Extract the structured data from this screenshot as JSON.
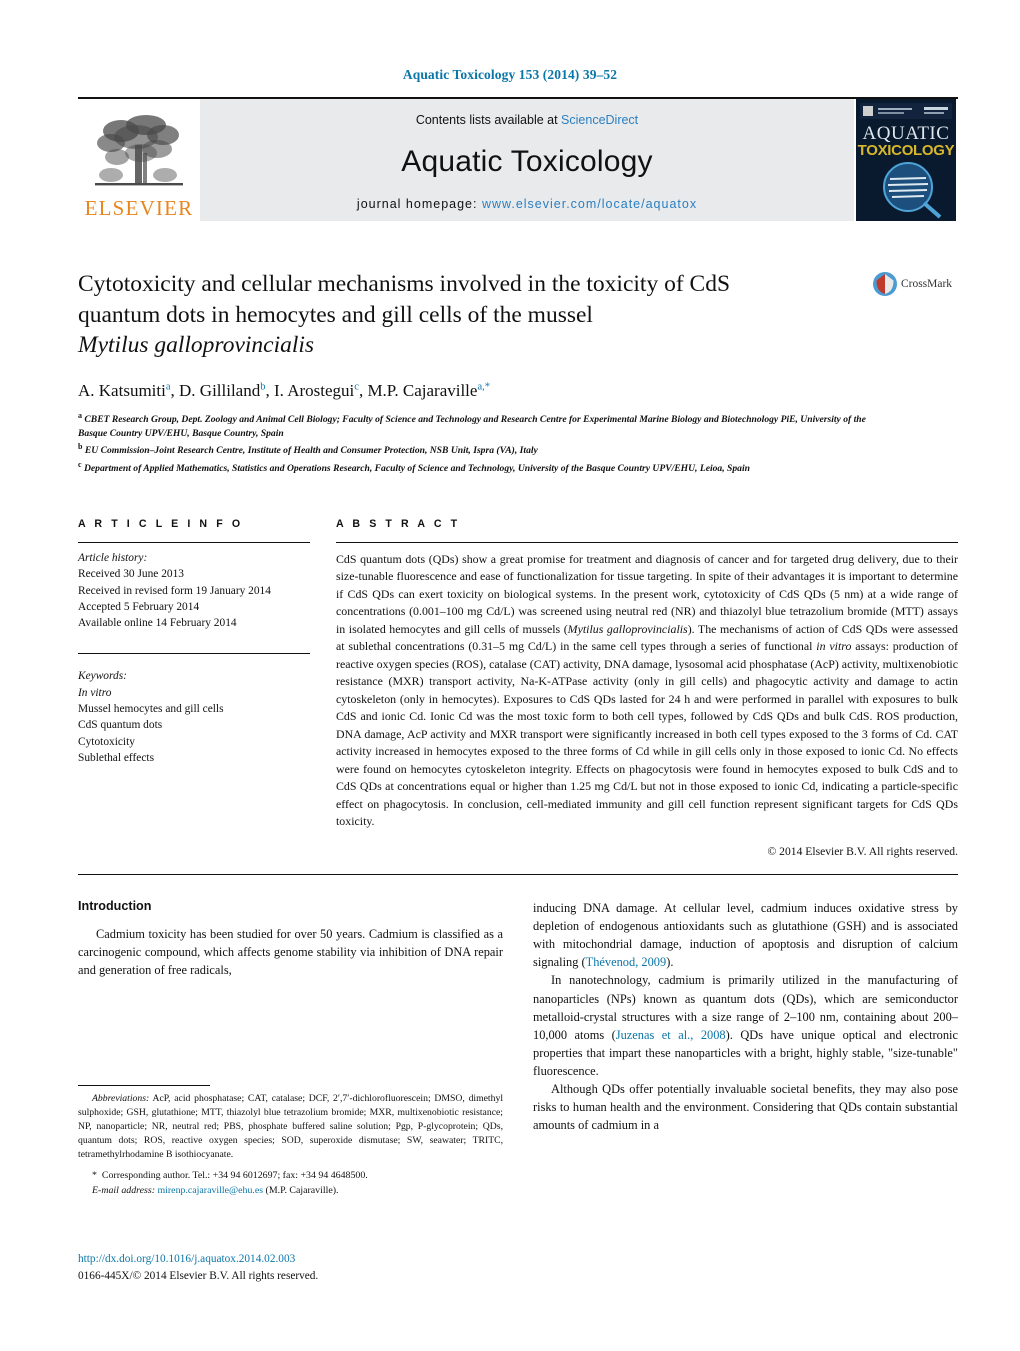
{
  "journal_ref": "Aquatic Toxicology 153 (2014) 39–52",
  "masthead": {
    "contents_prefix": "Contents lists available at ",
    "sciencedirect": "ScienceDirect",
    "journal_name": "Aquatic Toxicology",
    "homepage_prefix": "journal homepage: ",
    "homepage_url": "www.elsevier.com/locate/aquatox",
    "publisher_wordmark": "ELSEVIER",
    "cover_title_line1": "AQUATIC",
    "cover_title_line2": "TOXICOLOGY",
    "accent_link_color": "#2a7fc1",
    "elsevier_orange": "#e8861e",
    "band_background": "#e9eaec"
  },
  "article": {
    "title_line1": "Cytotoxicity and cellular mechanisms involved in the toxicity of CdS",
    "title_line2": "quantum dots in hemocytes and gill cells of the mussel",
    "title_species": "Mytilus galloprovincialis",
    "crossmark_label": "CrossMark",
    "authors": [
      {
        "name": "A. Katsumiti",
        "sup": "a"
      },
      {
        "name": "D. Gilliland",
        "sup": "b"
      },
      {
        "name": "I. Arostegui",
        "sup": "c"
      },
      {
        "name": "M.P. Cajaraville",
        "sup": "a,*"
      }
    ],
    "affiliations": [
      {
        "marker": "a",
        "text": "CBET Research Group, Dept. Zoology and Animal Cell Biology; Faculty of Science and Technology and Research Centre for Experimental Marine Biology and Biotechnology PiE, University of the Basque Country UPV/EHU, Basque Country, Spain"
      },
      {
        "marker": "b",
        "text": "EU Commission–Joint Research Centre, Institute of Health and Consumer Protection, NSB Unit, Ispra (VA), Italy"
      },
      {
        "marker": "c",
        "text": "Department of Applied Mathematics, Statistics and Operations Research, Faculty of Science and Technology, University of the Basque Country UPV/EHU, Leioa, Spain"
      }
    ]
  },
  "article_info": {
    "heading": "A R T I C L E  I N F O",
    "history_label": "Article history:",
    "history": [
      "Received 30 June 2013",
      "Received in revised form 19 January 2014",
      "Accepted 5 February 2014",
      "Available online 14 February 2014"
    ],
    "keywords_label": "Keywords:",
    "keywords": [
      "In vitro",
      "Mussel hemocytes and gill cells",
      "CdS quantum dots",
      "Cytotoxicity",
      "Sublethal effects"
    ]
  },
  "abstract": {
    "heading": "A B S T R A C T",
    "paragraph_part1": "CdS quantum dots (QDs) show a great promise for treatment and diagnosis of cancer and for targeted drug delivery, due to their size-tunable fluorescence and ease of functionalization for tissue targeting. In spite of their advantages it is important to determine if CdS QDs can exert toxicity on biological systems. In the present work, cytotoxicity of CdS QDs (5 nm) at a wide range of concentrations (0.001–100 mg Cd/L) was screened using neutral red (NR) and thiazolyl blue tetrazolium bromide (MTT) assays in isolated hemocytes and gill cells of mussels (",
    "italic1": "Mytilus galloprovincialis",
    "paragraph_part2": "). The mechanisms of action of CdS QDs were assessed at sublethal concentrations (0.31–5 mg Cd/L) in the same cell types through a series of functional ",
    "italic2": "in vitro",
    "paragraph_part3": " assays: production of reactive oxygen species (ROS), catalase (CAT) activity, DNA damage, lysosomal acid phosphatase (AcP) activity, multixenobiotic resistance (MXR) transport activity, Na-K-ATPase activity (only in gill cells) and phagocytic activity and damage to actin cytoskeleton (only in hemocytes). Exposures to CdS QDs lasted for 24 h and were performed in parallel with exposures to bulk CdS and ionic Cd. Ionic Cd was the most toxic form to both cell types, followed by CdS QDs and bulk CdS. ROS production, DNA damage, AcP activity and MXR transport were significantly increased in both cell types exposed to the 3 forms of Cd. CAT activity increased in hemocytes exposed to the three forms of Cd while in gill cells only in those exposed to ionic Cd. No effects were found on hemocytes cytoskeleton integrity. Effects on phagocytosis were found in hemocytes exposed to bulk CdS and to CdS QDs at concentrations equal or higher than 1.25 mg Cd/L but not in those exposed to ionic Cd, indicating a particle-specific effect on phagocytosis. In conclusion, cell-mediated immunity and gill cell function represent significant targets for CdS QDs toxicity.",
    "copyright": "© 2014 Elsevier B.V. All rights reserved."
  },
  "introduction": {
    "heading": "Introduction",
    "left_para1": "Cadmium toxicity has been studied for over 50 years. Cadmium is classified as a carcinogenic compound, which affects genome stability via inhibition of DNA repair and generation of free radicals,",
    "right_para1_a": "inducing DNA damage. At cellular level, cadmium induces oxidative stress by depletion of endogenous antioxidants such as glutathione (GSH) and is associated with mitochondrial damage, induction of apoptosis and disruption of calcium signaling (",
    "right_para1_cite": "Thévenod, 2009",
    "right_para1_b": ").",
    "right_para2_a": "In nanotechnology, cadmium is primarily utilized in the manufacturing of nanoparticles (NPs) known as quantum dots (QDs), which are semiconductor metalloid-crystal structures with a size range of 2–100 nm, containing about 200–10,000 atoms (",
    "right_para2_cite": "Juzenas et al., 2008",
    "right_para2_b": "). QDs have unique optical and electronic properties that impart these nanoparticles with a bright, highly stable, \"size-tunable\" fluorescence.",
    "right_para3": "Although QDs offer potentially invaluable societal benefits, they may also pose risks to human health and the environment. Considering that QDs contain substantial amounts of cadmium in a"
  },
  "footnotes": {
    "abbrev_label": "Abbreviations:",
    "abbrev_text": "AcP, acid phosphatase; CAT, catalase; DCF, 2′,7′-dichlorofluorescein; DMSO, dimethyl sulphoxide; GSH, glutathione; MTT, thiazolyl blue tetrazolium bromide; MXR, multixenobiotic resistance; NP, nanoparticle; NR, neutral red; PBS, phosphate buffered saline solution; Pgp, P-glycoprotein; QDs, quantum dots; ROS, reactive oxygen species; SOD, superoxide dismutase; SW, seawater; TRITC, tetramethylrhodamine B isothiocyanate.",
    "corresponding": "Corresponding author. Tel.: +34 94 6012697; fax: +34 94 4648500.",
    "email_label": "E-mail address:",
    "email": "mirenp.cajaraville@ehu.es",
    "email_owner": "(M.P. Cajaraville)."
  },
  "footer": {
    "doi": "http://dx.doi.org/10.1016/j.aquatox.2014.02.003",
    "issn_line": "0166-445X/© 2014 Elsevier B.V. All rights reserved."
  }
}
